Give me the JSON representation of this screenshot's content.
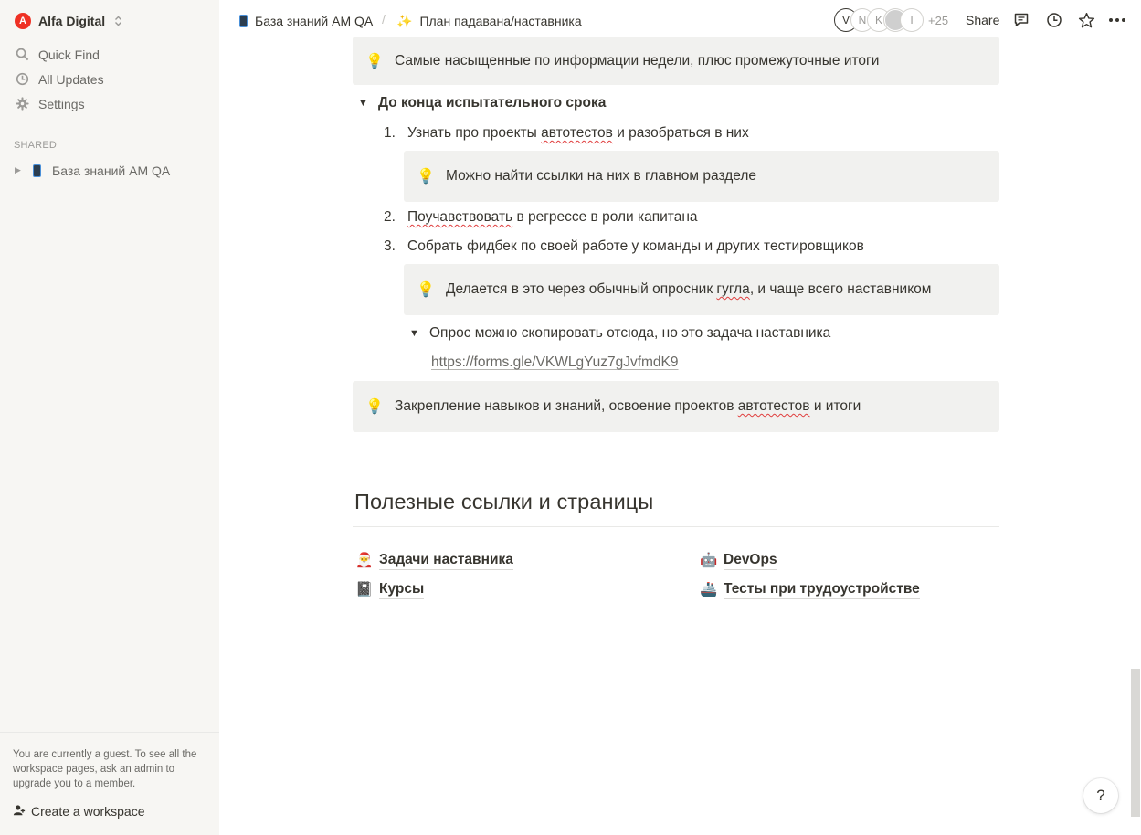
{
  "sidebar": {
    "workspace": {
      "logo_letter": "A",
      "name": "Alfa Digital"
    },
    "nav": [
      {
        "label": "Quick Find",
        "icon": "search-icon"
      },
      {
        "label": "All Updates",
        "icon": "clock-icon"
      },
      {
        "label": "Settings",
        "icon": "gear-icon"
      }
    ],
    "shared_label": "SHARED",
    "tree": [
      {
        "label": "База знаний AM QA",
        "icon": "phone-icon"
      }
    ],
    "footer": {
      "guest_text": "You are currently a guest. To see all the workspace pages, ask an admin to upgrade you to a member.",
      "create_label": "Create a workspace"
    }
  },
  "topbar": {
    "breadcrumbs": [
      {
        "label": "База знаний AM QA",
        "icon": "phone-icon"
      },
      {
        "label": "План падавана/наставника",
        "icon": "sparkles-icon"
      }
    ],
    "separator": "/",
    "avatars": [
      "V",
      "N",
      "K",
      "",
      "I"
    ],
    "avatar_more": "+25",
    "share_label": "Share"
  },
  "content": {
    "callout_top": "Самые насыщенные по информации недели, плюс промежуточные итоги",
    "toggle_heading": "До конца испытательного срока",
    "list": [
      {
        "num": "1.",
        "before": "Узнать про проекты ",
        "squiggle": "автотестов",
        "after": " и разобраться в них"
      },
      {
        "num": "2.",
        "before": "",
        "squiggle": "Поучавствовать",
        "after": " в регрессе в роли капитана"
      },
      {
        "num": "3.",
        "before": "Собрать фидбек по своей работе у команды и других тестировщиков",
        "squiggle": "",
        "after": ""
      }
    ],
    "callout_1": "Можно найти ссылки на них в главном разделе",
    "callout_2": {
      "before": "Делается в это через обычный опросник ",
      "squiggle": "гугла",
      "after": ", и чаще всего наставником"
    },
    "toggle_survey": "Опрос можно скопировать отсюда, но это задача наставника",
    "survey_link": "https://forms.gle/VKWLgYuz7gJvfmdK9",
    "callout_bottom": {
      "before": "Закрепление навыков и знаний, освоение проектов ",
      "squiggle": "автотестов",
      "after": " и итоги"
    },
    "section_heading": "Полезные ссылки и страницы",
    "page_links": [
      {
        "label": "Задачи наставника",
        "emoji": "santa-icon"
      },
      {
        "label": "Курсы",
        "emoji": "notebook-icon"
      },
      {
        "label": "DevOps",
        "emoji": "robot-icon"
      },
      {
        "label": "Тесты при трудоустройстве",
        "emoji": "ship-icon"
      }
    ]
  },
  "help_label": "?",
  "colors": {
    "sidebar_bg": "#f7f6f3",
    "callout_bg": "#f1f1ef",
    "text": "#37352f",
    "brand": "#ef3124",
    "spellcheck": "#e03e3e"
  }
}
